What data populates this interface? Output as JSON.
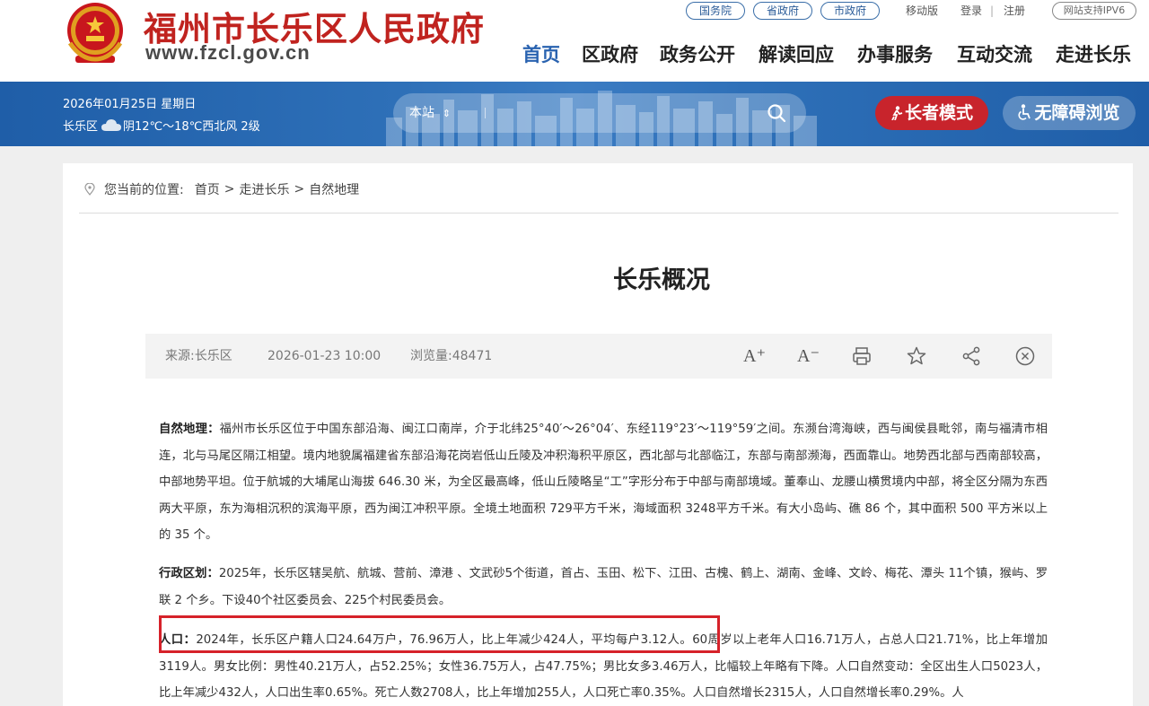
{
  "header": {
    "site_title": "福州市长乐区人民政府",
    "site_domain": "www.fzcl.gov.cn",
    "top_links": {
      "state_council": "国务院",
      "province": "省政府",
      "city": "市政府",
      "mobile": "移动版",
      "login": "登录",
      "separator": "|",
      "register": "注册",
      "ipv6": "网站支持IPV6"
    },
    "nav": [
      "首页",
      "区政府",
      "政务公开",
      "解读回应",
      "办事服务",
      "互动交流",
      "走进长乐"
    ]
  },
  "banner": {
    "date": "2026年01月25日 星期日",
    "location": "长乐区",
    "weather": "阴12℃～18℃西北风 2级",
    "search_scope": "本站",
    "search_scope_arrow": "⇕",
    "elder_mode": "长者模式",
    "accessible": "无障碍浏览"
  },
  "breadcrumb": {
    "prefix": "您当前的位置:",
    "items": [
      "首页",
      "走进长乐",
      "自然地理"
    ],
    "sep": ">"
  },
  "article": {
    "title": "长乐概况",
    "source": "来源:长乐区",
    "datetime": "2026-01-23 10:00",
    "views": "浏览量:48471",
    "tools": {
      "font_larger": "A⁺",
      "font_smaller": "A⁻"
    },
    "p1_lead": "自然地理：",
    "p1_body": "福州市长乐区位于中国东部沿海、闽江口南岸，介于北纬25°40′～26°04′、东经119°23′～119°59′之间。东濒台湾海峡，西与闽侯县毗邻，南与福清市相连，北与马尾区隔江相望。境内地貌属福建省东部沿海花岗岩低山丘陵及冲积海积平原区，西北部与北部临江，东部与南部濒海，西面靠山。地势西北部与西南部较高，中部地势平坦。位于航城的大埔尾山海拔 646.30 米，为全区最高峰，低山丘陵略呈“工”字形分布于中部与南部境域。董奉山、龙腰山横贯境内中部，将全区分隔为东西两大平原，东为海相沉积的滨海平原，西为闽江冲积平原。全境土地面积 729平方千米，海域面积 3248平方千米。有大小岛屿、礁 86 个，其中面积 500 平方米以上的 35 个。",
    "p2_lead": "行政区划：",
    "p2_body": "2025年，长乐区辖吴航、航城、营前、漳港 、文武砂5个街道，首占、玉田、松下、江田、古槐、鹤上、湖南、金峰、文岭、梅花、潭头 11个镇，猴屿、罗联 2 个乡。下设40个社区委员会、225个村民委员会。",
    "p3_lead": "人口：",
    "p3_body": "2024年，长乐区户籍人口24.64万户，76.96万人，比上年减少424人，平均每户3.12人。60周岁以上老年人口16.71万人，占总人口21.71%，比上年增加3119人。男女比例：男性40.21万人，占52.25%；女性36.75万人，占47.75%；男比女多3.46万人，比幅较上年略有下降。人口自然变动：全区出生人口5023人，比上年减少432人，人口出生率0.65%。死亡人数2708人，比上年增加255人，人口死亡率0.35%。人口自然增长2315人，人口自然增长率0.29%。人"
  },
  "colors": {
    "brand_red": "#c0231f",
    "nav_active": "#2a63b0",
    "banner_blue": "#2e70b8",
    "elder_btn": "#c8242c",
    "highlight": "#d6222a"
  }
}
